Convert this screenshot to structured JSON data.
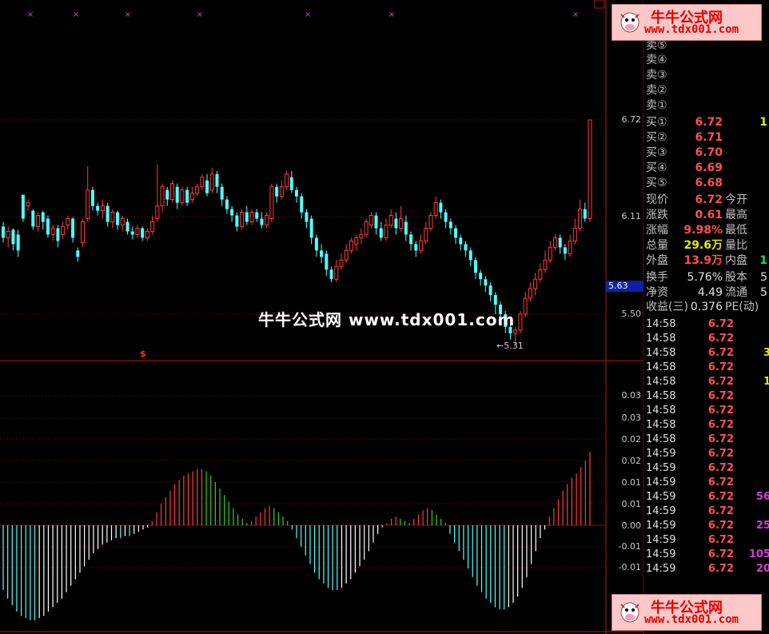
{
  "main_chart": {
    "price_axis": [
      "6.72",
      "6.11",
      "5.50"
    ],
    "current_price_tag": "5.63",
    "low_marker": "←5.31",
    "signal_mark": "$",
    "candles": [
      [
        6.05,
        5.98,
        6.08,
        5.95
      ],
      [
        5.98,
        6.02,
        6.05,
        5.92
      ],
      [
        6.03,
        5.94,
        6.04,
        5.9
      ],
      [
        6.0,
        5.9,
        6.03,
        5.86
      ],
      [
        6.25,
        6.1,
        6.25,
        6.08
      ],
      [
        6.18,
        6.2,
        6.22,
        6.15
      ],
      [
        6.15,
        6.05,
        6.16,
        6.03
      ],
      [
        6.05,
        6.12,
        6.14,
        6.02
      ],
      [
        6.14,
        6.08,
        6.15,
        6.03
      ],
      [
        6.1,
        6.0,
        6.12,
        5.98
      ],
      [
        6.0,
        6.04,
        6.06,
        5.96
      ],
      [
        6.04,
        5.96,
        6.06,
        5.92
      ],
      [
        6.0,
        6.05,
        6.08,
        5.97
      ],
      [
        6.06,
        6.1,
        6.12,
        6.03
      ],
      [
        6.1,
        5.98,
        6.11,
        5.95
      ],
      [
        5.9,
        5.86,
        5.92,
        5.83
      ],
      [
        5.95,
        6.08,
        6.1,
        5.92
      ],
      [
        6.1,
        6.28,
        6.43,
        6.08
      ],
      [
        6.28,
        6.18,
        6.3,
        6.15
      ],
      [
        6.18,
        6.15,
        6.2,
        6.12
      ],
      [
        6.15,
        6.18,
        6.22,
        6.1
      ],
      [
        6.18,
        6.08,
        6.2,
        6.05
      ],
      [
        6.08,
        6.14,
        6.16,
        6.04
      ],
      [
        6.14,
        6.06,
        6.15,
        6.03
      ],
      [
        6.06,
        6.1,
        6.12,
        6.02
      ],
      [
        6.08,
        6.02,
        6.1,
        6.0
      ],
      [
        6.02,
        6.0,
        6.05,
        5.97
      ],
      [
        6.0,
        6.04,
        6.06,
        5.98
      ],
      [
        6.04,
        5.98,
        6.05,
        5.96
      ],
      [
        5.98,
        6.02,
        6.04,
        5.96
      ],
      [
        6.02,
        6.08,
        6.12,
        6.0
      ],
      [
        6.1,
        6.18,
        6.44,
        6.08
      ],
      [
        6.18,
        6.3,
        6.32,
        6.14
      ],
      [
        6.28,
        6.22,
        6.3,
        6.18
      ],
      [
        6.22,
        6.32,
        6.34,
        6.2
      ],
      [
        6.3,
        6.2,
        6.32,
        6.16
      ],
      [
        6.2,
        6.28,
        6.3,
        6.18
      ],
      [
        6.28,
        6.2,
        6.3,
        6.18
      ],
      [
        6.22,
        6.26,
        6.3,
        6.2
      ],
      [
        6.26,
        6.3,
        6.32,
        6.24
      ],
      [
        6.3,
        6.36,
        6.38,
        6.28
      ],
      [
        6.34,
        6.26,
        6.38,
        6.24
      ],
      [
        6.28,
        6.38,
        6.42,
        6.26
      ],
      [
        6.38,
        6.3,
        6.4,
        6.26
      ],
      [
        6.3,
        6.22,
        6.32,
        6.18
      ],
      [
        6.22,
        6.16,
        6.24,
        6.13
      ],
      [
        6.16,
        6.12,
        6.18,
        6.08
      ],
      [
        6.12,
        6.05,
        6.14,
        6.02
      ],
      [
        6.05,
        6.14,
        6.16,
        6.03
      ],
      [
        6.14,
        6.08,
        6.18,
        6.06
      ],
      [
        6.08,
        6.14,
        6.16,
        6.06
      ],
      [
        6.14,
        6.1,
        6.16,
        6.08
      ],
      [
        6.1,
        6.06,
        6.14,
        6.04
      ],
      [
        6.06,
        6.12,
        6.14,
        6.04
      ],
      [
        6.1,
        6.3,
        6.32,
        6.08
      ],
      [
        6.3,
        6.24,
        6.32,
        6.2
      ],
      [
        6.24,
        6.3,
        6.34,
        6.22
      ],
      [
        6.3,
        6.38,
        6.4,
        6.28
      ],
      [
        6.36,
        6.28,
        6.4,
        6.26
      ],
      [
        6.28,
        6.24,
        6.3,
        6.2
      ],
      [
        6.24,
        6.14,
        6.26,
        6.1
      ],
      [
        6.14,
        6.08,
        6.16,
        6.04
      ],
      [
        6.1,
        5.98,
        6.12,
        5.94
      ],
      [
        5.98,
        5.9,
        6.0,
        5.86
      ],
      [
        5.9,
        5.86,
        5.94,
        5.82
      ],
      [
        5.88,
        5.78,
        5.9,
        5.74
      ],
      [
        5.78,
        5.72,
        5.8,
        5.7
      ],
      [
        5.72,
        5.8,
        5.84,
        5.7
      ],
      [
        5.8,
        5.84,
        5.88,
        5.78
      ],
      [
        5.84,
        5.9,
        5.94,
        5.82
      ],
      [
        5.9,
        5.96,
        5.98,
        5.88
      ],
      [
        5.94,
        5.98,
        6.0,
        5.9
      ],
      [
        5.98,
        6.0,
        6.04,
        5.94
      ],
      [
        6.0,
        6.08,
        6.1,
        5.98
      ],
      [
        6.06,
        6.12,
        6.14,
        6.04
      ],
      [
        6.12,
        6.04,
        6.14,
        6.0
      ],
      [
        6.04,
        5.98,
        6.08,
        5.96
      ],
      [
        5.98,
        6.06,
        6.1,
        5.96
      ],
      [
        6.06,
        6.12,
        6.16,
        6.04
      ],
      [
        6.1,
        6.04,
        6.14,
        6.0
      ],
      [
        6.04,
        6.1,
        6.18,
        6.02
      ],
      [
        6.08,
        6.0,
        6.12,
        5.96
      ],
      [
        6.0,
        5.94,
        6.02,
        5.9
      ],
      [
        5.94,
        5.9,
        5.96,
        5.86
      ],
      [
        5.9,
        5.96,
        6.0,
        5.88
      ],
      [
        5.96,
        6.04,
        6.08,
        5.94
      ],
      [
        6.04,
        6.12,
        6.14,
        6.02
      ],
      [
        6.12,
        6.2,
        6.24,
        6.1
      ],
      [
        6.2,
        6.14,
        6.22,
        6.1
      ],
      [
        6.14,
        6.08,
        6.16,
        6.04
      ],
      [
        6.08,
        6.04,
        6.1,
        6.0
      ],
      [
        6.04,
        5.98,
        6.06,
        5.94
      ],
      [
        5.98,
        5.94,
        6.0,
        5.9
      ],
      [
        5.94,
        5.9,
        5.96,
        5.86
      ],
      [
        5.9,
        5.84,
        5.92,
        5.8
      ],
      [
        5.84,
        5.76,
        5.86,
        5.72
      ],
      [
        5.76,
        5.72,
        5.78,
        5.68
      ],
      [
        5.72,
        5.68,
        5.74,
        5.64
      ],
      [
        5.68,
        5.62,
        5.7,
        5.58
      ],
      [
        5.62,
        5.56,
        5.64,
        5.5
      ],
      [
        5.56,
        5.5,
        5.58,
        5.44
      ],
      [
        5.5,
        5.42,
        5.52,
        5.38
      ],
      [
        5.42,
        5.38,
        5.44,
        5.34
      ],
      [
        5.38,
        5.4,
        5.42,
        5.31
      ],
      [
        5.4,
        5.5,
        5.52,
        5.38
      ],
      [
        5.5,
        5.6,
        5.64,
        5.48
      ],
      [
        5.6,
        5.66,
        5.7,
        5.58
      ],
      [
        5.66,
        5.72,
        5.76,
        5.62
      ],
      [
        5.72,
        5.78,
        5.82,
        5.7
      ],
      [
        5.78,
        5.84,
        5.9,
        5.76
      ],
      [
        5.84,
        5.92,
        5.96,
        5.82
      ],
      [
        5.92,
        5.98,
        6.0,
        5.9
      ],
      [
        5.98,
        5.92,
        6.0,
        5.88
      ],
      [
        5.92,
        5.88,
        5.94,
        5.84
      ],
      [
        5.88,
        5.96,
        6.0,
        5.86
      ],
      [
        5.96,
        6.04,
        6.1,
        5.94
      ],
      [
        6.04,
        6.16,
        6.22,
        6.02
      ],
      [
        6.16,
        6.1,
        6.2,
        6.08
      ],
      [
        6.1,
        6.72,
        6.72,
        6.08
      ]
    ]
  },
  "indicator": {
    "axis_labels": [
      "0.03",
      "0.03",
      "0.02",
      "0.02",
      "0.01",
      "0.01",
      "0.00",
      "-0.01",
      "-0.01"
    ],
    "bars": [
      -0.03,
      -0.034,
      -0.037,
      -0.04,
      -0.042,
      -0.043,
      -0.044,
      -0.044,
      -0.043,
      -0.042,
      -0.04,
      -0.038,
      -0.036,
      -0.034,
      -0.031,
      -0.028,
      -0.025,
      -0.022,
      -0.019,
      -0.016,
      -0.013,
      -0.011,
      -0.009,
      -0.008,
      -0.007,
      -0.006,
      -0.006,
      -0.005,
      -0.005,
      -0.004,
      -0.003,
      -0.002,
      -0.001,
      0.002,
      0.006,
      0.01,
      0.013,
      0.016,
      0.019,
      0.021,
      0.023,
      0.024,
      0.025,
      0.026,
      0.026,
      0.025,
      0.023,
      0.02,
      0.017,
      0.014,
      0.011,
      0.008,
      0.005,
      0.003,
      0.001,
      0.002,
      0.004,
      0.006,
      0.008,
      0.009,
      0.008,
      0.006,
      0.004,
      0.002,
      -0.002,
      -0.006,
      -0.01,
      -0.014,
      -0.018,
      -0.022,
      -0.025,
      -0.027,
      -0.029,
      -0.03,
      -0.03,
      -0.029,
      -0.027,
      -0.025,
      -0.022,
      -0.019,
      -0.016,
      -0.012,
      -0.008,
      -0.004,
      -0.001,
      0.001,
      0.003,
      0.004,
      0.003,
      0.002,
      0.001,
      0.003,
      0.005,
      0.007,
      0.008,
      0.007,
      0.005,
      0.003,
      0.001,
      -0.004,
      -0.008,
      -0.012,
      -0.016,
      -0.02,
      -0.024,
      -0.028,
      -0.031,
      -0.034,
      -0.036,
      -0.038,
      -0.039,
      -0.039,
      -0.038,
      -0.036,
      -0.033,
      -0.029,
      -0.024,
      -0.018,
      -0.012,
      -0.006,
      -0.002,
      0.004,
      0.008,
      0.012,
      0.016,
      0.019,
      0.022,
      0.024,
      0.027,
      0.03,
      0.034
    ]
  },
  "order_book": {
    "sells": [
      {
        "label": "卖⑤",
        "price": ""
      },
      {
        "label": "卖④",
        "price": ""
      },
      {
        "label": "卖③",
        "price": ""
      },
      {
        "label": "卖②",
        "price": ""
      },
      {
        "label": "卖①",
        "price": ""
      }
    ],
    "buys": [
      {
        "label": "买①",
        "price": "6.72",
        "vol": "1"
      },
      {
        "label": "买②",
        "price": "6.71",
        "vol": ""
      },
      {
        "label": "买③",
        "price": "6.70",
        "vol": ""
      },
      {
        "label": "买④",
        "price": "6.69",
        "vol": ""
      },
      {
        "label": "买⑤",
        "price": "6.68",
        "vol": ""
      }
    ]
  },
  "stats": {
    "rows": [
      {
        "l1": "现价",
        "v1": "6.72",
        "c1": "red",
        "l2": "今开",
        "v2": ""
      },
      {
        "l1": "涨跌",
        "v1": "0.61",
        "c1": "red",
        "l2": "最高",
        "v2": ""
      },
      {
        "l1": "涨幅",
        "v1": "9.98%",
        "c1": "red",
        "l2": "最低",
        "v2": ""
      },
      {
        "l1": "总量",
        "v1": "29.6万",
        "c1": "yellow",
        "l2": "量比",
        "v2": ""
      },
      {
        "l1": "外盘",
        "v1": "13.9万",
        "c1": "red",
        "l2": "内盘",
        "v2": "1"
      }
    ],
    "rows2": [
      {
        "l1": "换手",
        "v1": "5.76%",
        "l2": "股本",
        "v2": "5"
      },
      {
        "l1": "净资",
        "v1": "4.49",
        "l2": "流通",
        "v2": "5"
      },
      {
        "l1": "收益(三)",
        "v1": "0.376",
        "l2": "PE(动)",
        "v2": ""
      }
    ]
  },
  "ticks": [
    {
      "time": "14:58",
      "price": "6.72",
      "vol": ""
    },
    {
      "time": "14:58",
      "price": "6.72",
      "vol": ""
    },
    {
      "time": "14:58",
      "price": "6.72",
      "vol": "3"
    },
    {
      "time": "14:58",
      "price": "6.72",
      "vol": ""
    },
    {
      "time": "14:58",
      "price": "6.72",
      "vol": "1"
    },
    {
      "time": "14:58",
      "price": "6.72",
      "vol": ""
    },
    {
      "time": "14:58",
      "price": "6.72",
      "vol": ""
    },
    {
      "time": "14:58",
      "price": "6.72",
      "vol": ""
    },
    {
      "time": "14:58",
      "price": "6.72",
      "vol": ""
    },
    {
      "time": "14:59",
      "price": "6.72",
      "vol": ""
    },
    {
      "time": "14:59",
      "price": "6.72",
      "vol": ""
    },
    {
      "time": "14:59",
      "price": "6.72",
      "vol": ""
    },
    {
      "time": "14:59",
      "price": "6.72",
      "vol": "56"
    },
    {
      "time": "14:59",
      "price": "6.72",
      "vol": ""
    },
    {
      "time": "14:59",
      "price": "6.72",
      "vol": "25"
    },
    {
      "time": "14:59",
      "price": "6.72",
      "vol": ""
    },
    {
      "time": "14:59",
      "price": "6.72",
      "vol": "105"
    },
    {
      "time": "14:59",
      "price": "6.72",
      "vol": "20"
    }
  ],
  "watermark": {
    "center": "牛牛公式网 www.tdx001.com",
    "logo_title": "牛牛公式网",
    "logo_url": "www.tdx001.com"
  },
  "colors": {
    "up": "#ff3c3c",
    "down": "#54ffff",
    "grid": "#8a1010",
    "border": "#b01818",
    "macd_pos_up": "#ff3c3c",
    "macd_pos_down": "#30d030",
    "macd_neg_down": "#54ffff",
    "macd_neg_up": "#ffffff"
  }
}
